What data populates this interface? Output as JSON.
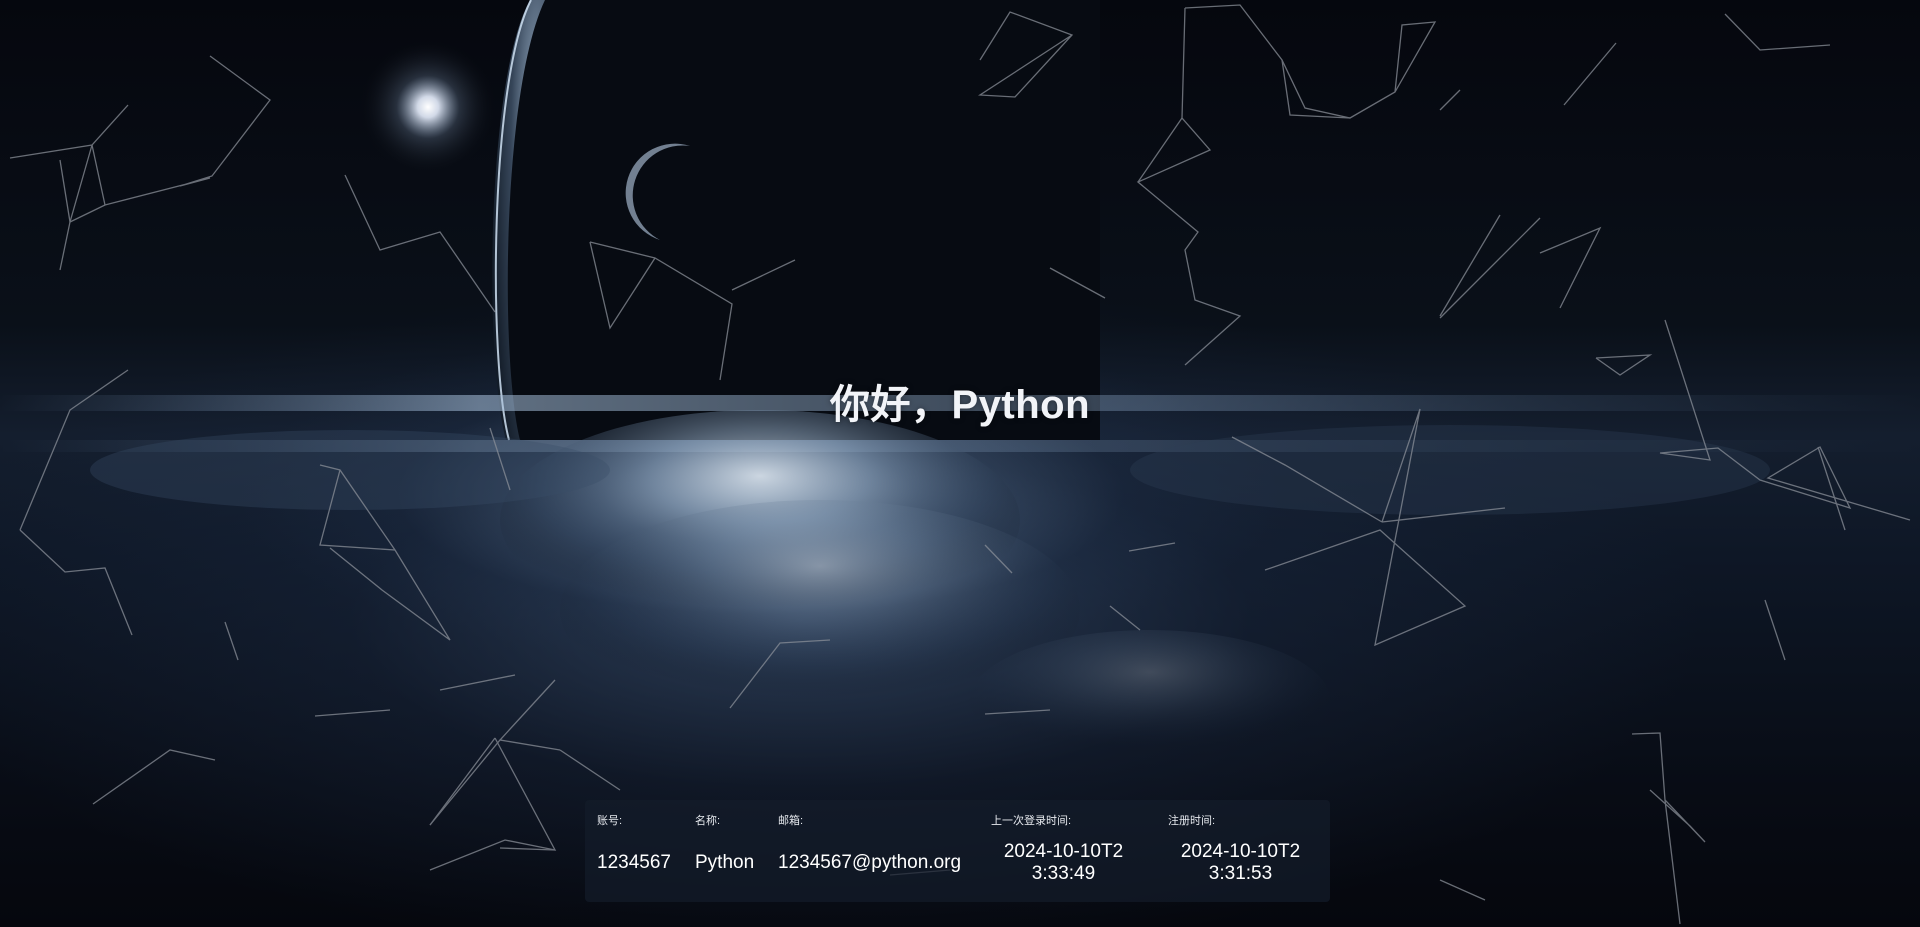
{
  "greeting": "你好，Python",
  "user_info": {
    "account": {
      "label": "账号:",
      "value": "1234567"
    },
    "name": {
      "label": "名称:",
      "value": "Python"
    },
    "email": {
      "label": "邮箱:",
      "value": "1234567@python.org"
    },
    "last_login": {
      "label": "上一次登录时间:",
      "value": "2024-10-10T23:33:49"
    },
    "register_time": {
      "label": "注册时间:",
      "value": "2024-10-10T23:31:53"
    }
  },
  "colors": {
    "background": "#05070d",
    "panel": "#141c2a",
    "text": "#ffffff",
    "network_lines": "#8a8f98"
  }
}
